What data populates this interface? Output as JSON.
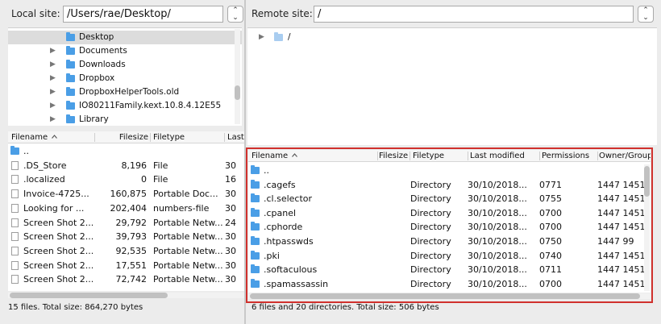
{
  "local": {
    "site_label": "Local site:",
    "path": "/Users/rae/Desktop/",
    "tree": [
      {
        "label": "Desktop",
        "selected": true,
        "has_children": false
      },
      {
        "label": "Documents",
        "selected": false,
        "has_children": true
      },
      {
        "label": "Downloads",
        "selected": false,
        "has_children": true
      },
      {
        "label": "Dropbox",
        "selected": false,
        "has_children": true
      },
      {
        "label": "DropboxHelperTools.old",
        "selected": false,
        "has_children": true
      },
      {
        "label": "IO80211Family.kext.10.8.4.12E55",
        "selected": false,
        "has_children": true
      },
      {
        "label": "Library",
        "selected": false,
        "has_children": true
      }
    ],
    "columns": [
      "Filename",
      "Filesize",
      "Filetype",
      "Last"
    ],
    "files": [
      {
        "name": "..",
        "size": "",
        "type": "",
        "last": "",
        "kind": "folder"
      },
      {
        "name": ".DS_Store",
        "size": "8,196",
        "type": "File",
        "last": "30",
        "kind": "file"
      },
      {
        "name": ".localized",
        "size": "0",
        "type": "File",
        "last": "16",
        "kind": "file"
      },
      {
        "name": "Invoice-4725...",
        "size": "160,875",
        "type": "Portable Doc...",
        "last": "30",
        "kind": "file"
      },
      {
        "name": "Looking for ...",
        "size": "202,404",
        "type": "numbers-file",
        "last": "30",
        "kind": "file"
      },
      {
        "name": "Screen Shot 2...",
        "size": "29,792",
        "type": "Portable Netw...",
        "last": "24",
        "kind": "file"
      },
      {
        "name": "Screen Shot 2...",
        "size": "39,793",
        "type": "Portable Netw...",
        "last": "30",
        "kind": "file"
      },
      {
        "name": "Screen Shot 2...",
        "size": "92,535",
        "type": "Portable Netw...",
        "last": "30",
        "kind": "file"
      },
      {
        "name": "Screen Shot 2...",
        "size": "17,551",
        "type": "Portable Netw...",
        "last": "30",
        "kind": "file"
      },
      {
        "name": "Screen Shot 2...",
        "size": "72,742",
        "type": "Portable Netw...",
        "last": "30",
        "kind": "file"
      }
    ],
    "status": "15 files. Total size: 864,270 bytes"
  },
  "remote": {
    "site_label": "Remote site:",
    "path": "/",
    "tree": [
      {
        "label": "/",
        "selected": false,
        "has_children": true
      }
    ],
    "columns": [
      "Filename",
      "Filesize",
      "Filetype",
      "Last modified",
      "Permissions",
      "Owner/Group"
    ],
    "files": [
      {
        "name": "..",
        "type": "",
        "modified": "",
        "perms": "",
        "owner": ""
      },
      {
        "name": ".cagefs",
        "type": "Directory",
        "modified": "30/10/2018...",
        "perms": "0771",
        "owner": "1447 1451"
      },
      {
        "name": ".cl.selector",
        "type": "Directory",
        "modified": "30/10/2018...",
        "perms": "0755",
        "owner": "1447 1451"
      },
      {
        "name": ".cpanel",
        "type": "Directory",
        "modified": "30/10/2018...",
        "perms": "0700",
        "owner": "1447 1451"
      },
      {
        "name": ".cphorde",
        "type": "Directory",
        "modified": "30/10/2018...",
        "perms": "0700",
        "owner": "1447 1451"
      },
      {
        "name": ".htpasswds",
        "type": "Directory",
        "modified": "30/10/2018...",
        "perms": "0750",
        "owner": "1447 99"
      },
      {
        "name": ".pki",
        "type": "Directory",
        "modified": "30/10/2018...",
        "perms": "0740",
        "owner": "1447 1451"
      },
      {
        "name": ".softaculous",
        "type": "Directory",
        "modified": "30/10/2018...",
        "perms": "0711",
        "owner": "1447 1451"
      },
      {
        "name": ".spamassassin",
        "type": "Directory",
        "modified": "30/10/2018...",
        "perms": "0700",
        "owner": "1447 1451"
      }
    ],
    "status": "6 files and 20 directories. Total size: 506 bytes"
  },
  "icons": {
    "dropdown": "up-down-chevron-icon",
    "folder": "folder-icon",
    "file": "file-icon",
    "expand": "disclosure-triangle-icon",
    "sort": "sort-ascending-icon"
  },
  "colors": {
    "folder": "#4a9ee6",
    "highlight": "#d0312d",
    "selection": "#dcdcdc"
  }
}
